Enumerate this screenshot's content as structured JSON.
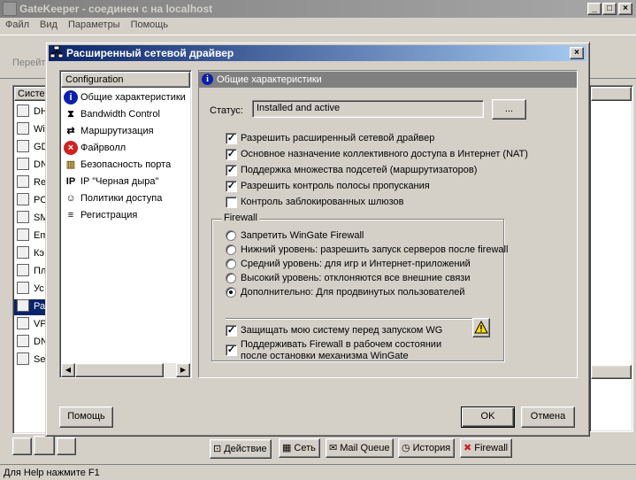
{
  "window": {
    "title": "GateKeeper - соединен с на localhost"
  },
  "menubar": {
    "items": [
      "Файл",
      "Вид",
      "Параметры",
      "Помощь"
    ]
  },
  "toolbar": {
    "partial_label": "Перейт"
  },
  "left_panel": {
    "header": "Систем",
    "items": [
      "DH",
      "Wi",
      "GD",
      "DN",
      "Re",
      "PO",
      "SM",
      "Em",
      "Кэ",
      "Пл",
      "Ус",
      "Ра",
      "VP",
      "DN",
      "Se"
    ],
    "selected_index": 11
  },
  "dialog": {
    "title": "Расширенный сетевой драйвер",
    "nav": {
      "header": "Configuration",
      "items": [
        {
          "label": "Общие характеристики",
          "icon": "info-icon"
        },
        {
          "label": "Bandwidth Control",
          "icon": "bandwidth-icon"
        },
        {
          "label": "Маршрутизация",
          "icon": "routing-icon"
        },
        {
          "label": "Файрволл",
          "icon": "firewall-icon"
        },
        {
          "label": "Безопасность порта",
          "icon": "port-security-icon"
        },
        {
          "label": "IP \"Черная дыра\"",
          "icon": "ip-icon"
        },
        {
          "label": "Политики доступа",
          "icon": "policy-icon"
        },
        {
          "label": "Регистрация",
          "icon": "log-icon"
        }
      ]
    },
    "section_title": "Общие характеристики",
    "status": {
      "label": "Статус:",
      "value": "Installed and active",
      "button": "..."
    },
    "options": [
      {
        "label": "Разрешить расширенный сетевой драйвер",
        "checked": true
      },
      {
        "label": "Основное назначение коллективного доступа в Интернет (NAT)",
        "checked": true
      },
      {
        "label": "Поддержка множества подсетей (маршрутизаторов)",
        "checked": true
      },
      {
        "label": "Разрешить контроль полосы пропускания",
        "checked": true
      },
      {
        "label": "Контроль заблокированных шлюзов",
        "checked": false
      }
    ],
    "firewall": {
      "legend": "Firewall",
      "levels": [
        {
          "label": "Запретить WinGate Firewall",
          "selected": false
        },
        {
          "label": "Нижний уровень: разрешить запуск серверов после firewall",
          "selected": false
        },
        {
          "label": "Средний уровень: для игр и Интернет-приложений",
          "selected": false
        },
        {
          "label": "Высокий уровень: отклоняются все внешние связи",
          "selected": false
        },
        {
          "label": "Дополнительно: Для продвинутых пользователей",
          "selected": true
        }
      ],
      "protect": {
        "label": "Защищать мою систему перед запуском WG",
        "checked": true
      },
      "keep_line1": "Поддерживать Firewall в рабочем состоянии",
      "keep_line2": "после остановки механизма WinGate",
      "keep_checked": true
    },
    "buttons": {
      "help": "Помощь",
      "ok": "OK",
      "cancel": "Отмена"
    }
  },
  "bottom_tabs": [
    "Действие",
    "Сеть",
    "Mail Queue",
    "История",
    "Firewall"
  ],
  "statusbar": {
    "text": "Для Help нажмите F1"
  }
}
